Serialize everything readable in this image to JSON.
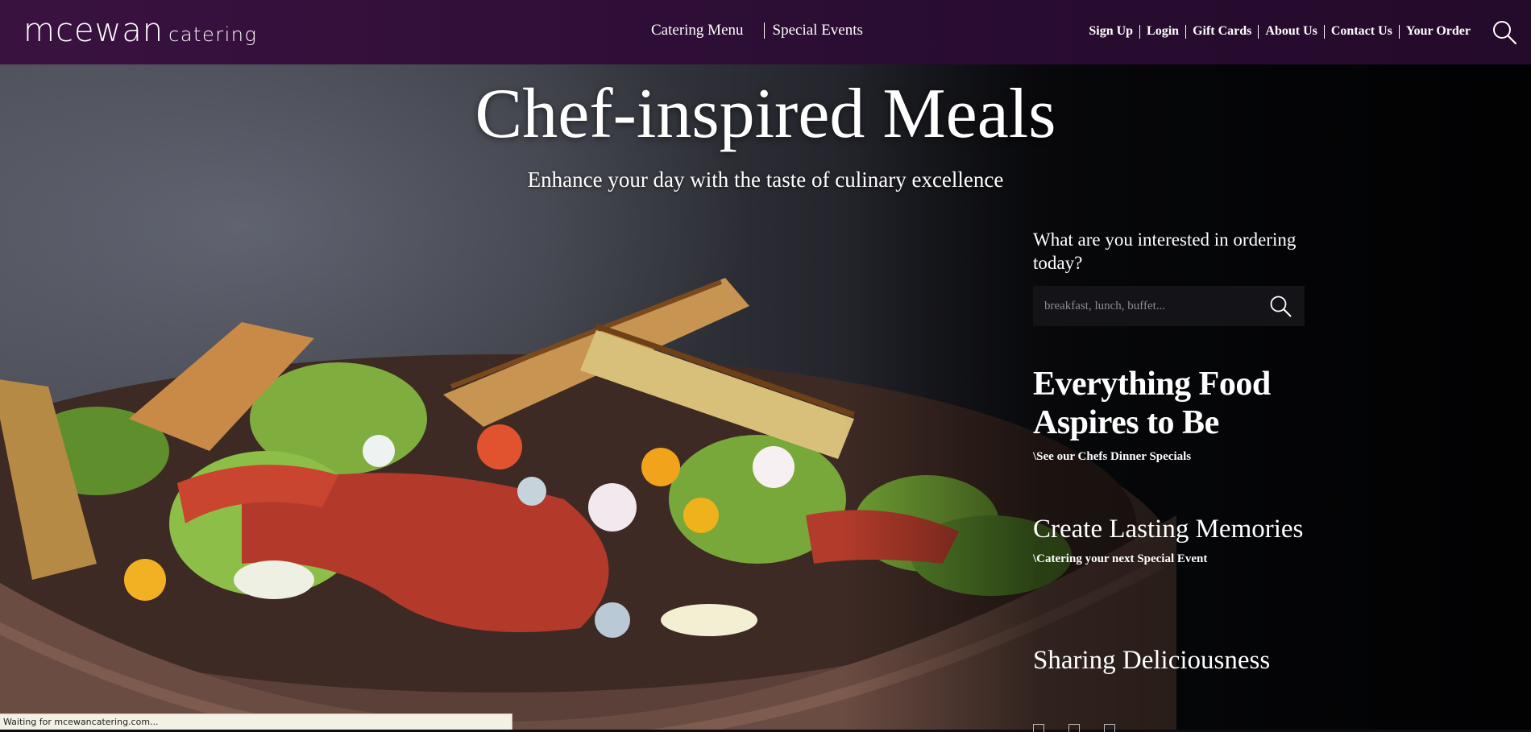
{
  "header": {
    "logo_word": "mcewan",
    "logo_sub": "catering",
    "center_nav": [
      "Catering Menu",
      "Special Events"
    ],
    "right_nav": [
      "Sign Up",
      "Login",
      "Gift Cards",
      "About Us",
      "Contact Us",
      "Your Order"
    ],
    "search_icon": "search-icon"
  },
  "hero": {
    "title": "Chef-inspired Meals",
    "subtitle": "Enhance your day with the taste of culinary excellence",
    "image": "salad-bowl-photo"
  },
  "order": {
    "question": "What are you interested in ordering today?",
    "placeholder": "breakfast, lunch, buffet...",
    "search_icon": "search-icon"
  },
  "features": [
    {
      "title": "Everything Food Aspires to Be",
      "link": "\\See our Chefs Dinner Specials"
    },
    {
      "title": "Create Lasting Memories",
      "link": "\\Catering your next Special Event"
    },
    {
      "title": "Sharing Deliciousness"
    }
  ],
  "status_bar": {
    "text": "Waiting for mcewancatering.com..."
  },
  "colors": {
    "header_bg": "#2b0d33",
    "text": "#ffffff",
    "search_bg": "#141418"
  }
}
